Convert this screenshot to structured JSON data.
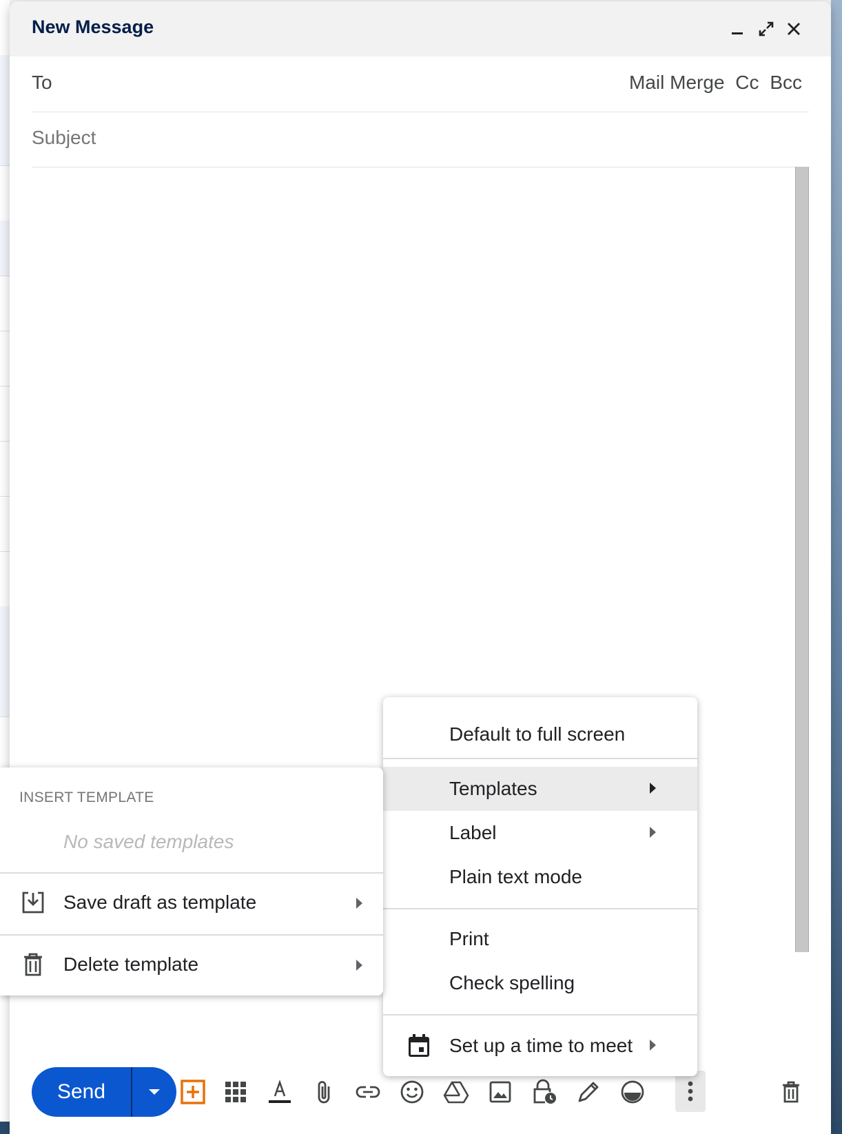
{
  "compose": {
    "title": "New Message",
    "to_label": "To",
    "recipient_links": [
      "Mail Merge",
      "Cc",
      "Bcc"
    ],
    "subject_placeholder": "Subject",
    "send_label": "Send"
  },
  "more_options_menu": {
    "items": [
      {
        "label": "Default to full screen"
      },
      {
        "label": "Templates",
        "has_submenu": true,
        "highlighted": true
      },
      {
        "label": "Label",
        "has_submenu": true
      },
      {
        "label": "Plain text mode"
      },
      {
        "label": "Print"
      },
      {
        "label": "Check spelling"
      },
      {
        "label": "Set up a time to meet",
        "has_submenu": true,
        "icon": "calendar-icon"
      }
    ]
  },
  "templates_submenu": {
    "heading": "INSERT TEMPLATE",
    "empty_text": "No saved templates",
    "items": [
      {
        "label": "Save draft as template",
        "icon": "save-template-icon"
      },
      {
        "label": "Delete template",
        "icon": "trash-icon"
      }
    ]
  },
  "toolbar_icons": [
    "mail-merge-icon",
    "apps-grid-icon",
    "text-format-icon",
    "attach-icon",
    "link-icon",
    "emoji-icon",
    "drive-icon",
    "image-icon",
    "confidential-icon",
    "signature-icon",
    "layouts-icon",
    "more-options-icon",
    "discard-icon"
  ],
  "colors": {
    "send_button": "#0b57d0",
    "header_bg": "#f2f2f2",
    "title_text": "#041e49",
    "highlight": "#ebebeb",
    "mail_merge_accent": "#e8710a"
  }
}
